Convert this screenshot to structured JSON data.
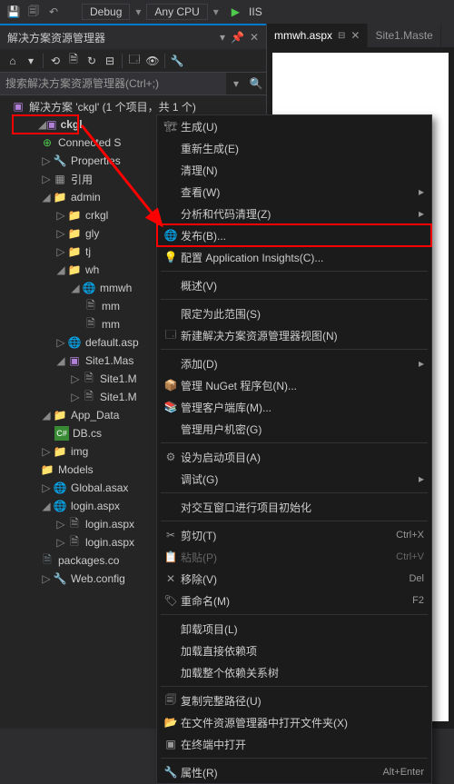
{
  "toolbar": {
    "config": "Debug",
    "platform": "Any CPU",
    "target": "IIS"
  },
  "panel": {
    "title": "解决方案资源管理器",
    "search_placeholder": "搜索解决方案资源管理器(Ctrl+;)"
  },
  "tree": {
    "solution": "解决方案 'ckgl' (1 个项目，共 1 个)",
    "project": "ckgl",
    "connected": "Connected S",
    "properties": "Properties",
    "references": "引用",
    "admin": "admin",
    "crkgl": "crkgl",
    "gly": "gly",
    "tj": "tj",
    "wh": "wh",
    "mmwh": "mmwh",
    "mm": "mm",
    "mm2": "mm",
    "default": "default.asp",
    "site1mas": "Site1.Mas",
    "site1m": "Site1.M",
    "site1m2": "Site1.M",
    "appdata": "App_Data",
    "dbcs": "DB.cs",
    "img": "img",
    "models": "Models",
    "globalasax": "Global.asax",
    "loginaspx": "login.aspx",
    "loginaspx2": "login.aspx",
    "loginaspx3": "login.aspx",
    "packages": "packages.co",
    "webconfig": "Web.config"
  },
  "tabs": {
    "t1": "mmwh.aspx",
    "t2": "Site1.Maste"
  },
  "menu": {
    "build": "生成(U)",
    "rebuild": "重新生成(E)",
    "clean": "清理(N)",
    "view": "查看(W)",
    "analyze": "分析和代码清理(Z)",
    "publish": "发布(B)...",
    "appinsights": "配置 Application Insights(C)...",
    "overview": "概述(V)",
    "scope": "限定为此范围(S)",
    "newview": "新建解决方案资源管理器视图(N)",
    "add": "添加(D)",
    "nuget": "管理 NuGet 程序包(N)...",
    "clientlib": "管理客户端库(M)...",
    "usersecrets": "管理用户机密(G)",
    "startup": "设为启动项目(A)",
    "debug": "调试(G)",
    "initwin": "对交互窗口进行项目初始化",
    "cut": "剪切(T)",
    "cut_sc": "Ctrl+X",
    "paste": "粘贴(P)",
    "paste_sc": "Ctrl+V",
    "remove": "移除(V)",
    "remove_sc": "Del",
    "rename": "重命名(M)",
    "rename_sc": "F2",
    "unload": "卸载项目(L)",
    "loaddeps": "加载直接依赖项",
    "loadtree": "加载整个依赖关系树",
    "copypath": "复制完整路径(U)",
    "openfolder": "在文件资源管理器中打开文件夹(X)",
    "openterm": "在终端中打开",
    "properties": "属性(R)",
    "properties_sc": "Alt+Enter"
  }
}
